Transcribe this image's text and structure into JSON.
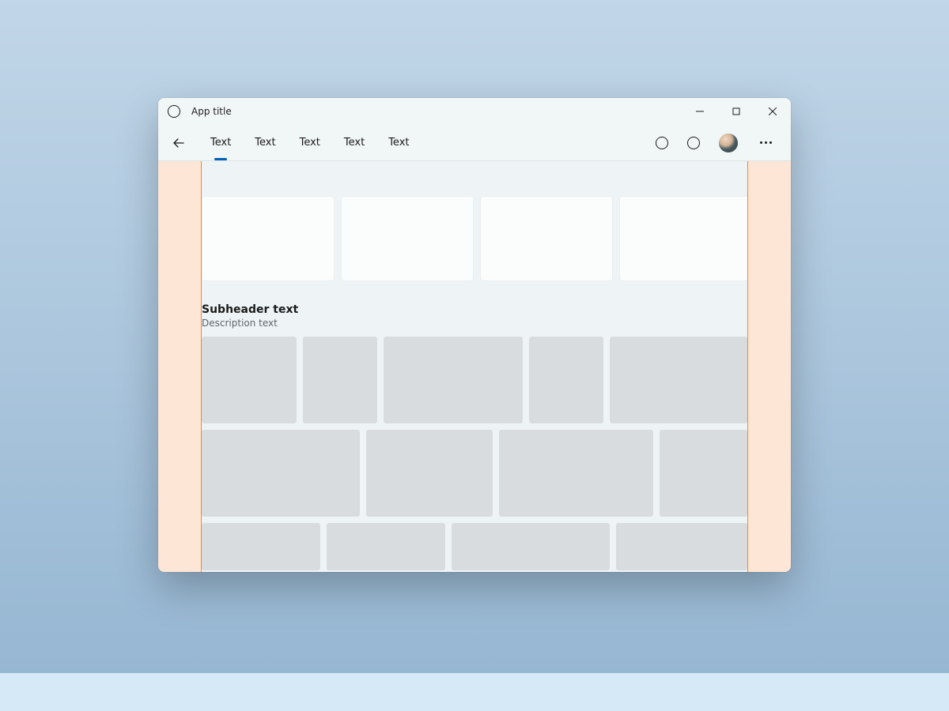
{
  "titlebar": {
    "title": "App title"
  },
  "nav": {
    "tabs": [
      {
        "label": "Text",
        "active": true
      },
      {
        "label": "Text"
      },
      {
        "label": "Text"
      },
      {
        "label": "Text"
      },
      {
        "label": "Text"
      }
    ]
  },
  "section": {
    "subheader": "Subheader text",
    "description": "Description text"
  }
}
